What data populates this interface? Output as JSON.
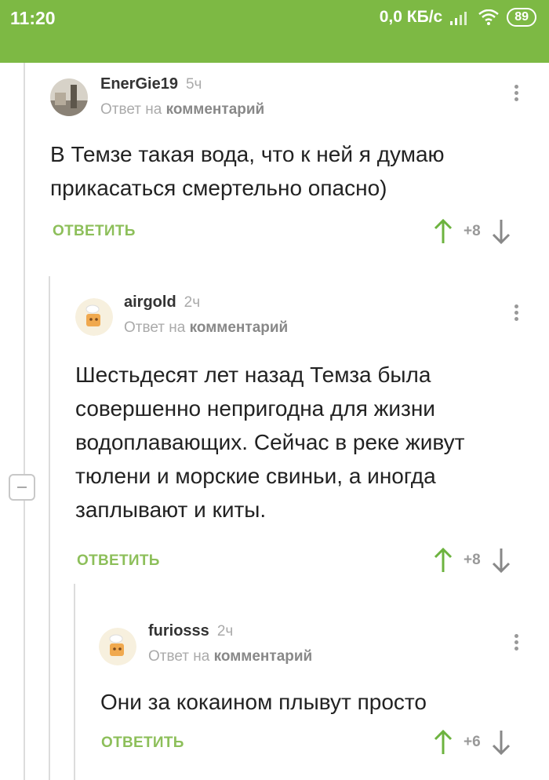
{
  "statusbar": {
    "time": "11:20",
    "network": "0,0 КБ/с",
    "battery": "89"
  },
  "comments": [
    {
      "username": "EnerGie19",
      "time": "5ч",
      "reply_prefix": "Ответ на",
      "reply_target": "комментарий",
      "text": "В Темзе такая вода, что к ней я думаю прикасаться смертельно опасно)",
      "reply_label": "ОТВЕТИТЬ",
      "votes": "+8"
    },
    {
      "username": "airgold",
      "time": "2ч",
      "reply_prefix": "Ответ на",
      "reply_target": "комментарий",
      "text": "Шестьдесят лет назад Темза была совершенно непригодна для жизни водоплавающих. Сейчас в реке живут тюлени и морские свиньи, а иногда заплывают и киты.",
      "reply_label": "ОТВЕТИТЬ",
      "votes": "+8"
    },
    {
      "username": "furiosss",
      "time": "2ч",
      "reply_prefix": "Ответ на",
      "reply_target": "комментарий",
      "text": "Они за кокаином плывут просто",
      "reply_label": "ОТВЕТИТЬ",
      "votes": "+6"
    }
  ],
  "colors": {
    "statusbar": "#7db944",
    "reply": "#8dbf5a",
    "upvote": "#6db33f"
  }
}
